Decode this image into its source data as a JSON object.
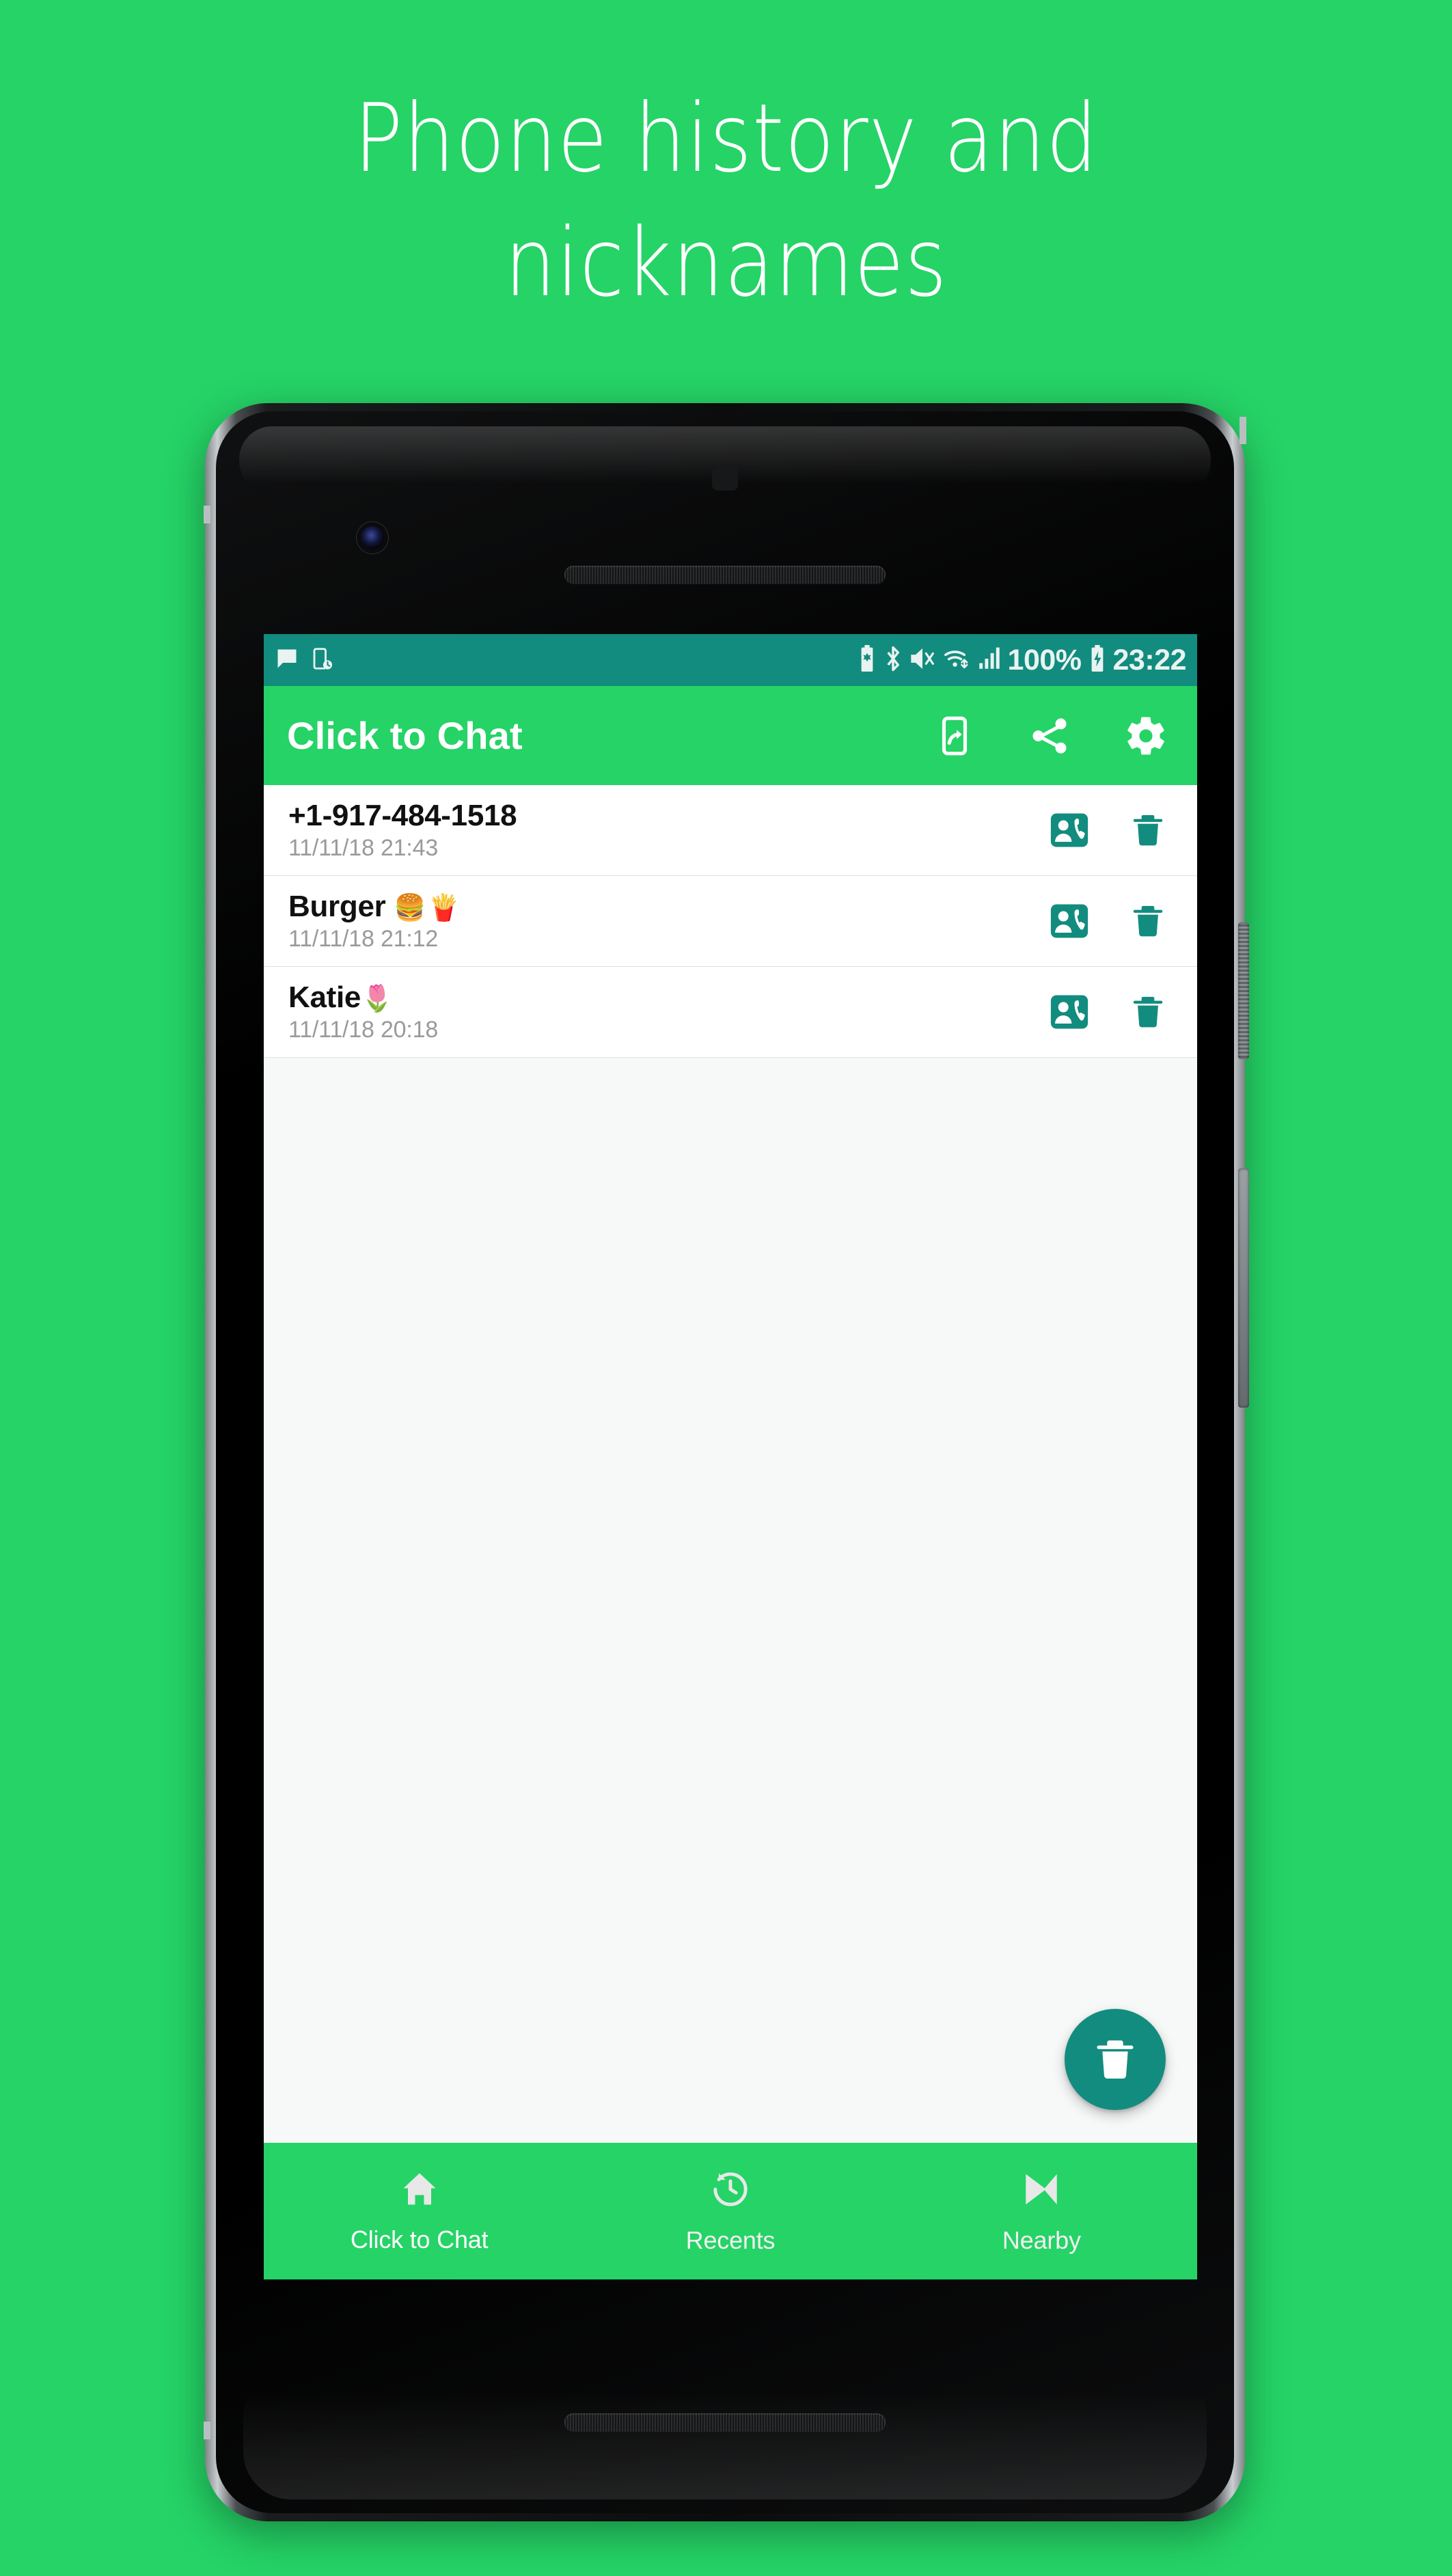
{
  "promo": {
    "headline_line1": "Phone history and",
    "headline_line2": "nicknames",
    "background_color": "#25D366"
  },
  "colors": {
    "brand_green": "#25D366",
    "status_teal": "#128C7E",
    "row_background": "#ffffff",
    "list_background": "#F7F8F8",
    "divider": "#E0E0E0",
    "muted_text": "#9A9A9A"
  },
  "statusbar": {
    "left_icons": [
      "message-icon",
      "screenshot-icon"
    ],
    "right_icons": [
      "battery-saver-icon",
      "bluetooth-icon",
      "mute-icon",
      "wifi-icon",
      "signal-icon",
      "charging-battery-icon"
    ],
    "battery_percent": "100%",
    "clock": "23:22"
  },
  "appbar": {
    "title": "Click to Chat",
    "actions": [
      {
        "name": "phone-forward-icon",
        "label": "Send to phone"
      },
      {
        "name": "share-icon",
        "label": "Share"
      },
      {
        "name": "gear-icon",
        "label": "Settings"
      }
    ]
  },
  "list": {
    "rows": [
      {
        "title": "+1-917-484-1518",
        "timestamp": "11/11/18 21:43",
        "emoji": "",
        "contact_action": "save-contact-icon",
        "delete_action": "delete-icon"
      },
      {
        "title": "Burger",
        "timestamp": "11/11/18 21:12",
        "emoji": "🍔🍟",
        "contact_action": "save-contact-icon",
        "delete_action": "delete-icon"
      },
      {
        "title": "Katie",
        "timestamp": "11/11/18 20:18",
        "emoji": "🌷",
        "contact_action": "save-contact-icon",
        "delete_action": "delete-icon"
      }
    ]
  },
  "fab": {
    "icon": "delete-icon",
    "label": "Clear all history"
  },
  "bottomnav": {
    "items": [
      {
        "label": "Click to Chat",
        "icon": "home-icon",
        "active": true
      },
      {
        "label": "Recents",
        "icon": "history-clock-icon",
        "active": false
      },
      {
        "label": "Nearby",
        "icon": "nearby-share-icon",
        "active": false
      }
    ]
  }
}
